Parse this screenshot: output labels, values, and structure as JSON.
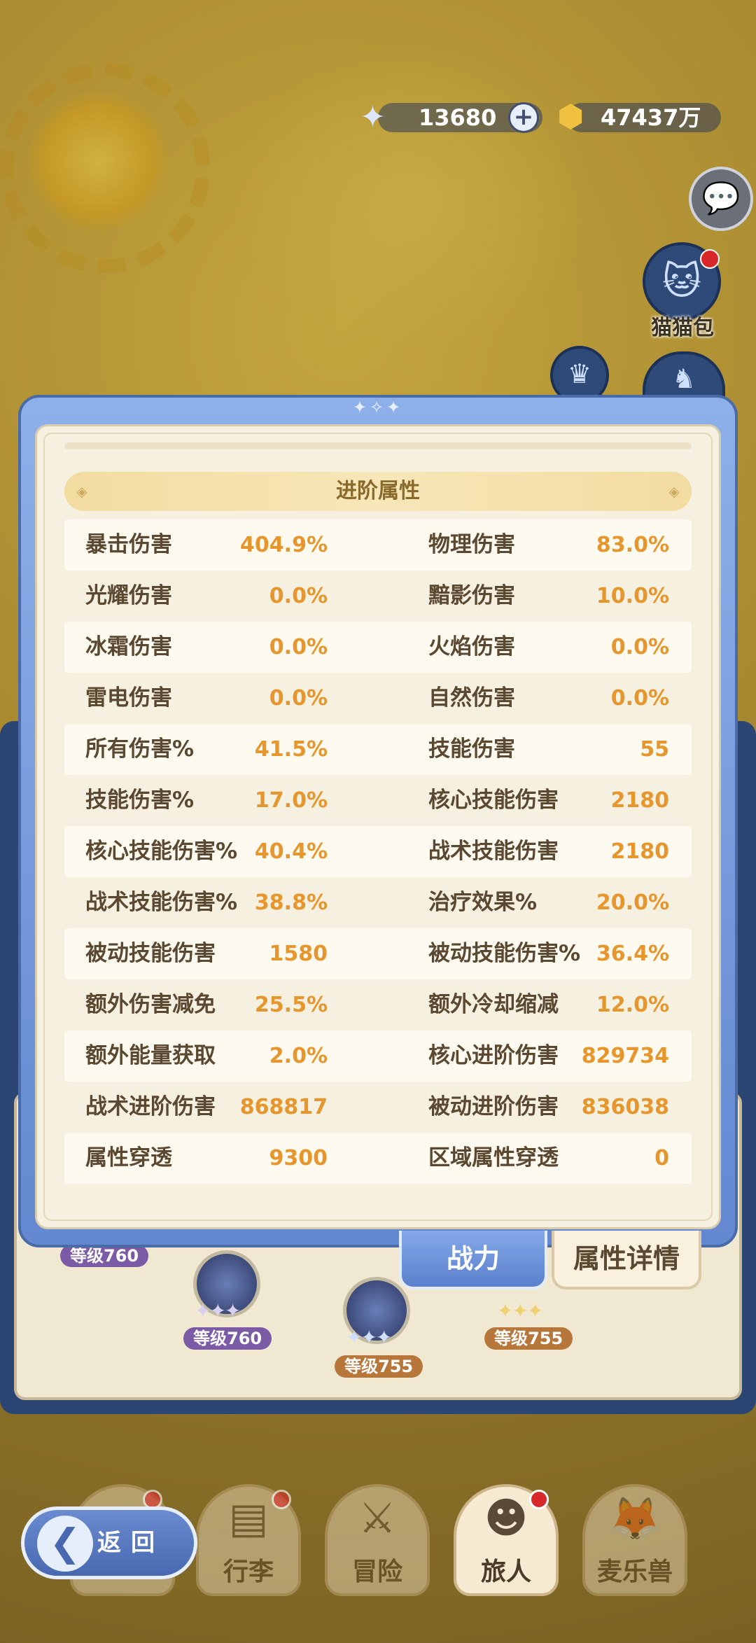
{
  "currency": {
    "gems": "13680",
    "coins": "47437万",
    "plus_symbol": "+"
  },
  "side": {
    "cat_bag_label": "猫猫包"
  },
  "background_skills": {
    "level_left_top": "等级760",
    "level_1": "等级760",
    "level_2": "等级755",
    "level_3": "等级755"
  },
  "modal": {
    "section_title": "进阶属性",
    "rows": [
      {
        "l1": "暴击伤害",
        "v1": "404.9%",
        "l2": "物理伤害",
        "v2": "83.0%"
      },
      {
        "l1": "光耀伤害",
        "v1": "0.0%",
        "l2": "黯影伤害",
        "v2": "10.0%"
      },
      {
        "l1": "冰霜伤害",
        "v1": "0.0%",
        "l2": "火焰伤害",
        "v2": "0.0%"
      },
      {
        "l1": "雷电伤害",
        "v1": "0.0%",
        "l2": "自然伤害",
        "v2": "0.0%"
      },
      {
        "l1": "所有伤害%",
        "v1": "41.5%",
        "l2": "技能伤害",
        "v2": "55"
      },
      {
        "l1": "技能伤害%",
        "v1": "17.0%",
        "l2": "核心技能伤害",
        "v2": "2180"
      },
      {
        "l1": "核心技能伤害%",
        "v1": "40.4%",
        "l2": "战术技能伤害",
        "v2": "2180"
      },
      {
        "l1": "战术技能伤害%",
        "v1": "38.8%",
        "l2": "治疗效果%",
        "v2": "20.0%"
      },
      {
        "l1": "被动技能伤害",
        "v1": "1580",
        "l2": "被动技能伤害%",
        "v2": "36.4%"
      },
      {
        "l1": "额外伤害减免",
        "v1": "25.5%",
        "l2": "额外冷却缩减",
        "v2": "12.0%"
      },
      {
        "l1": "额外能量获取",
        "v1": "2.0%",
        "l2": "核心进阶伤害",
        "v2": "829734"
      },
      {
        "l1": "战术进阶伤害",
        "v1": "868817",
        "l2": "被动进阶伤害",
        "v2": "836038"
      },
      {
        "l1": "属性穿透",
        "v1": "9300",
        "l2": "区域属性穿透",
        "v2": "0"
      }
    ],
    "tab_power": "战力",
    "tab_detail": "属性详情"
  },
  "nav": {
    "back_label": "返回",
    "items": [
      "行李",
      "冒险",
      "旅人",
      "麦乐兽"
    ],
    "active": "旅人"
  },
  "colors": {
    "value_orange": "#e6962c",
    "label_brown": "#5a4830",
    "frame_blue": "#6388cf",
    "header_gold": "#f3dca0"
  }
}
